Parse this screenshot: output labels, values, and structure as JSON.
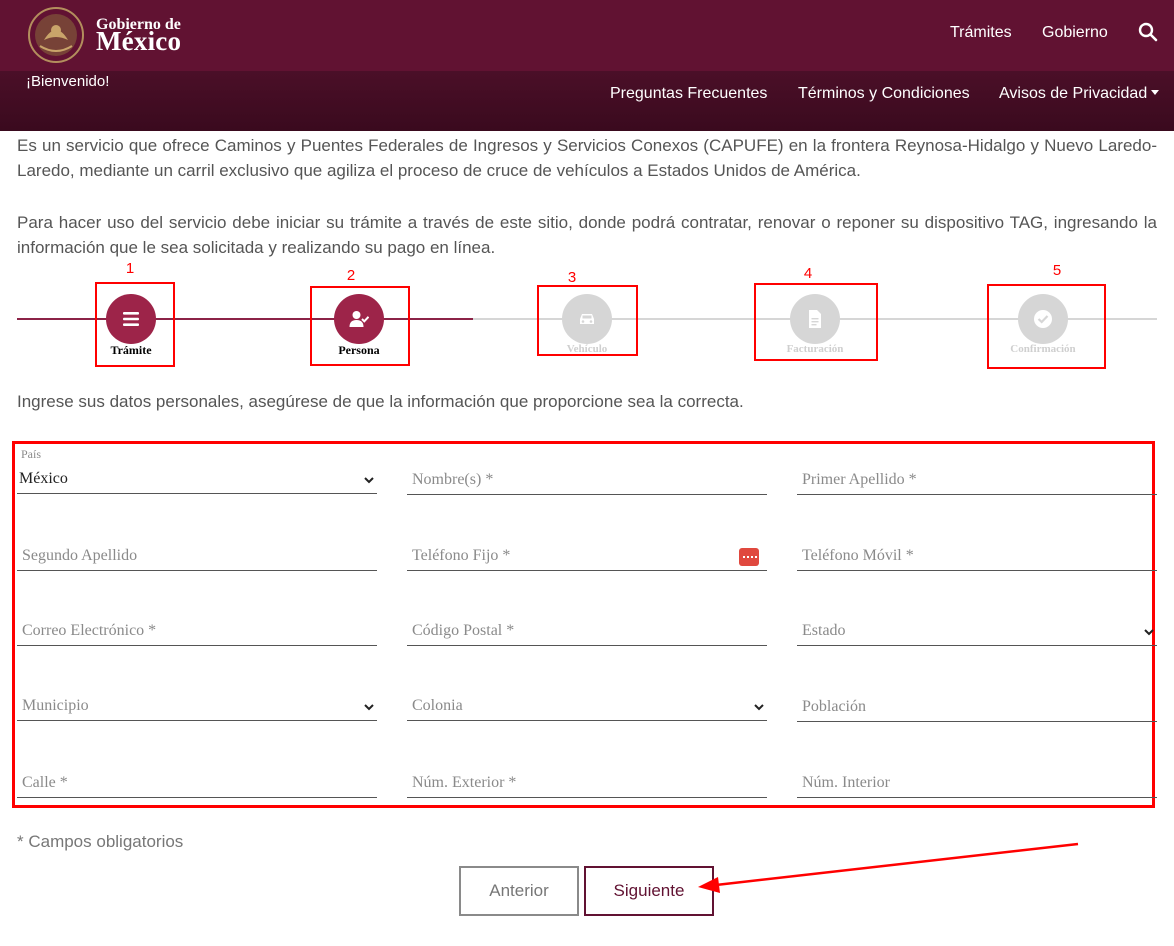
{
  "header": {
    "logo_small": "Gobierno de",
    "logo_big": "México",
    "nav": [
      "Trámites",
      "Gobierno"
    ],
    "welcome": "¡Bienvenido!",
    "subnav": [
      "Preguntas Frecuentes",
      "Términos y Condiciones",
      "Avisos de Privacidad"
    ]
  },
  "intro": {
    "p1": "Es un servicio que ofrece Caminos y Puentes Federales de Ingresos y Servicios Conexos (CAPUFE) en la frontera Reynosa-Hidalgo y Nuevo Laredo-Laredo, mediante un carril exclusivo que agiliza el proceso de cruce de vehículos a Estados Unidos de América.",
    "p2": "Para hacer uso del servicio debe iniciar su trámite a través de este sitio, donde podrá contratar, renovar o reponer su dispositivo TAG, ingresando la información que le sea solicitada y realizando su pago en línea."
  },
  "steps": [
    {
      "number": "1",
      "label": "Trámite",
      "state": "complete",
      "icon": "list-icon"
    },
    {
      "number": "2",
      "label": "Persona",
      "state": "active",
      "icon": "user-check-icon"
    },
    {
      "number": "3",
      "label": "Vehículo",
      "state": "inactive",
      "icon": "car-icon"
    },
    {
      "number": "4",
      "label": "Facturación",
      "state": "inactive",
      "icon": "document-icon"
    },
    {
      "number": "5",
      "label": "Confirmación",
      "state": "inactive",
      "icon": "check-circle-icon"
    }
  ],
  "form": {
    "instructions": "Ingrese sus datos personales, asegúrese de que la información que proporcione sea la correcta.",
    "pais_label": "País",
    "pais_value": "México",
    "fields": {
      "nombre": "Nombre(s) *",
      "primer_apellido": "Primer Apellido *",
      "segundo_apellido": "Segundo Apellido",
      "telefono_fijo": "Teléfono Fijo *",
      "telefono_movil": "Teléfono Móvil *",
      "correo": "Correo Electrónico *",
      "codigo_postal": "Código Postal *",
      "estado": "Estado",
      "municipio": "Municipio",
      "colonia": "Colonia",
      "poblacion": "Población",
      "calle": "Calle *",
      "num_exterior": "Núm. Exterior *",
      "num_interior": "Núm. Interior"
    },
    "required_note": "* Campos obligatorios"
  },
  "buttons": {
    "prev": "Anterior",
    "next": "Siguiente"
  },
  "colors": {
    "brand": "#611232",
    "accent": "#9d2449",
    "annotation": "#ff0000"
  }
}
